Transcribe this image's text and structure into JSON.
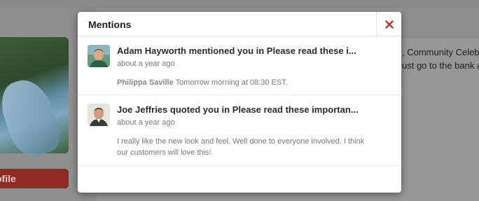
{
  "background": {
    "profile_button_label": "ofile",
    "text_line_1": ", Community Celeb",
    "text_line_2": "ust go to the bank a"
  },
  "modal": {
    "title": "Mentions",
    "close_icon": "close-icon",
    "accent_color": "#c0392b",
    "items": [
      {
        "title": "Adam Hayworth mentioned you in Please read these i...",
        "time": "about a year ago",
        "author": "Philippa Saville",
        "message": "Tomorrow morning at 08:30 EST."
      },
      {
        "title": "Joe Jeffries quoted you in Please read these importan...",
        "time": "about a year ago",
        "author": "",
        "message": "I really like the new look and feel. Well done to everyone involved. I think our customers will love this!"
      }
    ]
  }
}
